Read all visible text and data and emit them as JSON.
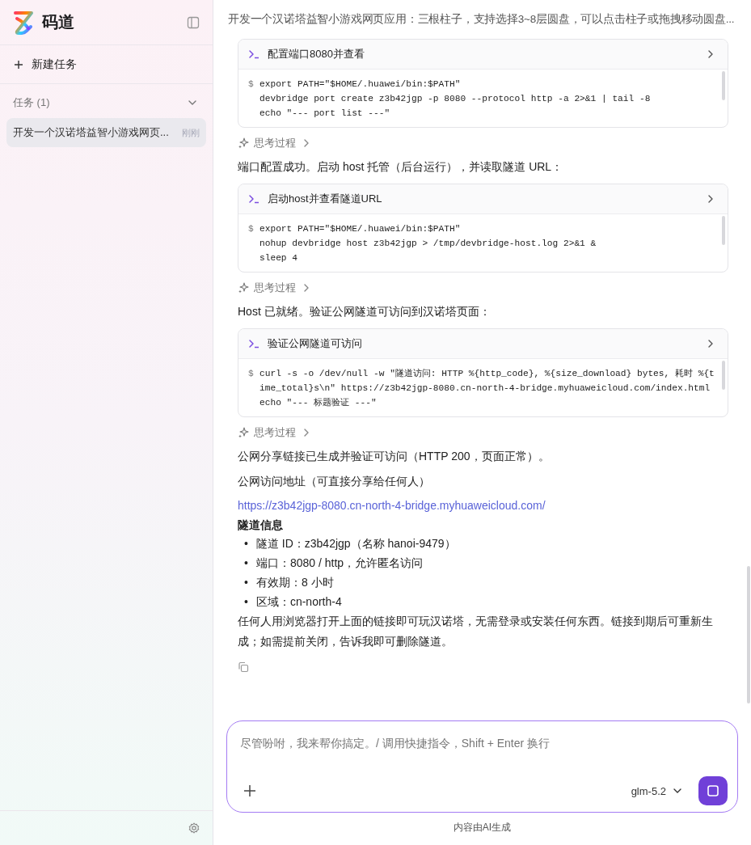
{
  "app": {
    "name": "码道"
  },
  "sidebar": {
    "new_task": "新建任务",
    "section": {
      "title": "任务 (1)",
      "expanded": true
    },
    "tasks": [
      {
        "title": "开发一个汉诺塔益智小游戏网页...",
        "time": "刚刚",
        "selected": true
      }
    ]
  },
  "header": {
    "title": "开发一个汉诺塔益智小游戏网页应用：三根柱子，支持选择3~8层圆盘，可以点击柱子或拖拽移动圆盘..."
  },
  "messages": [
    {
      "kind": "tool",
      "title": "配置端口8080并查看",
      "prompt": "$",
      "lines": [
        "export PATH=\"$HOME/.huawei/bin:$PATH\"",
        "devbridge port create z3b42jgp -p 8080 --protocol http -a 2>&1 | tail -8",
        "echo \"--- port list ---\""
      ]
    },
    {
      "kind": "thinking",
      "label": "思考过程"
    },
    {
      "kind": "text",
      "text": "端口配置成功。启动 host 托管（后台运行），并读取隧道 URL："
    },
    {
      "kind": "tool",
      "title": "启动host并查看隧道URL",
      "prompt": "$",
      "lines": [
        "export PATH=\"$HOME/.huawei/bin:$PATH\"",
        "nohup devbridge host z3b42jgp > /tmp/devbridge-host.log 2>&1 &",
        "sleep 4"
      ]
    },
    {
      "kind": "thinking",
      "label": "思考过程"
    },
    {
      "kind": "text",
      "text": "Host 已就绪。验证公网隧道可访问到汉诺塔页面："
    },
    {
      "kind": "tool",
      "title": "验证公网隧道可访问",
      "prompt": "$",
      "lines": [
        "curl -s -o /dev/null -w \"隧道访问: HTTP %{http_code}, %{size_download} bytes, 耗时 %{t",
        "ime_total}s\\n\" https://z3b42jgp-8080.cn-north-4-bridge.myhuaweicloud.com/index.html",
        "echo \"--- 标题验证 ---\""
      ]
    },
    {
      "kind": "thinking",
      "label": "思考过程"
    },
    {
      "kind": "text",
      "text": "公网分享链接已生成并验证可访问（HTTP 200，页面正常）。"
    },
    {
      "kind": "text",
      "text": "公网访问地址（可直接分享给任何人）"
    },
    {
      "kind": "link",
      "text": "https://z3b42jgp-8080.cn-north-4-bridge.myhuaweicloud.com/"
    },
    {
      "kind": "heading",
      "text": "隧道信息"
    },
    {
      "kind": "list",
      "marker": "•",
      "items": [
        "隧道 ID：z3b42jgp（名称 hanoi-9479）",
        "端口：8080 / http，允许匿名访问",
        "有效期：8 小时",
        "区域：cn-north-4"
      ]
    },
    {
      "kind": "text",
      "text": "任何人用浏览器打开上面的链接即可玩汉诺塔，无需登录或安装任何东西。链接到期后可重新生成；如需提前关闭，告诉我即可删除隧道。"
    },
    {
      "kind": "copy"
    }
  ],
  "composer": {
    "placeholder": "尽管吩咐，我来帮你搞定。/ 调用快捷指令，Shift + Enter 换行",
    "model": "glm-5.2",
    "running": true
  },
  "footer_note": "内容由AI生成"
}
